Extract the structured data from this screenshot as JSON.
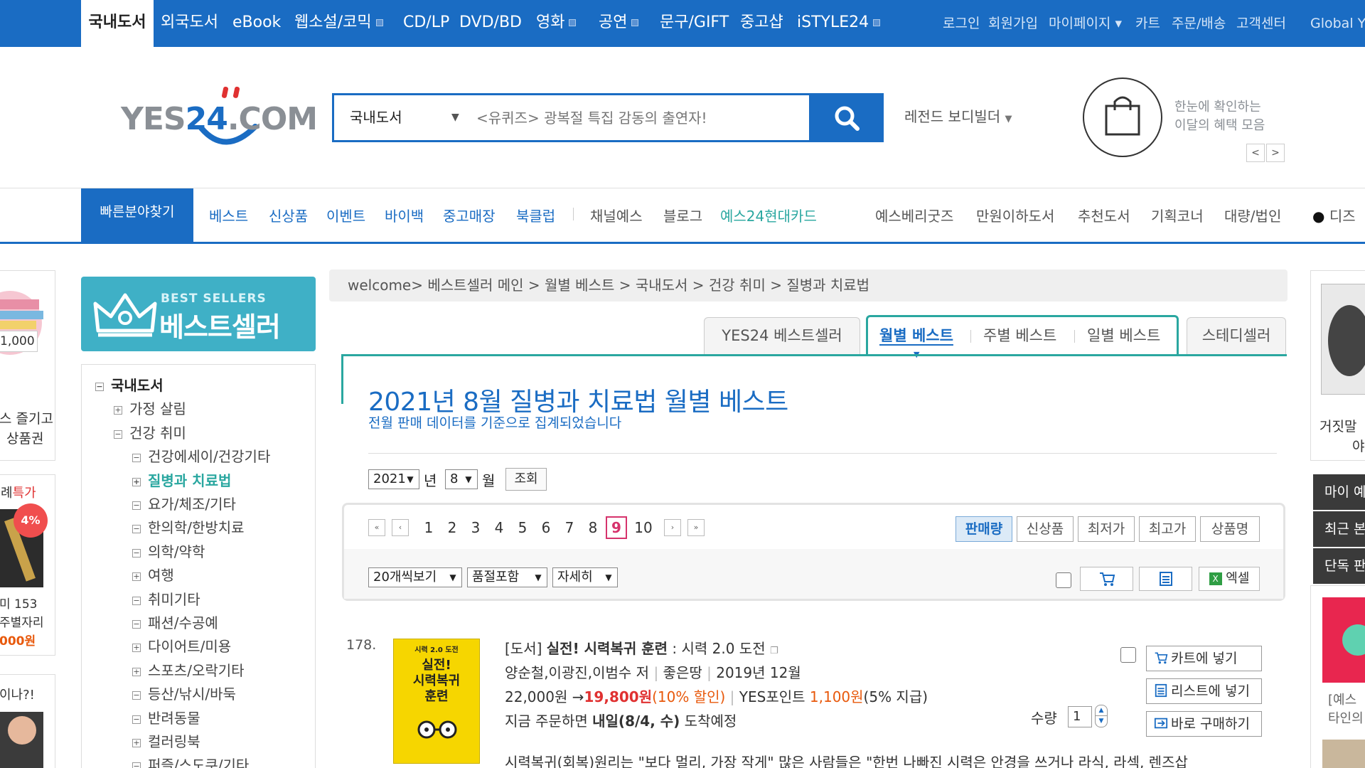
{
  "topnav": {
    "categories": [
      "국내도서",
      "외국도서",
      "eBook",
      "웹소설/코믹",
      "CD/LP",
      "DVD/BD",
      "영화",
      "공연",
      "문구/GIFT",
      "중고샵",
      "iSTYLE24"
    ],
    "utility": [
      "로그인",
      "회원가입",
      "마이페이지 ▾",
      "카트",
      "주문/배송",
      "고객센터",
      "Global Y"
    ]
  },
  "header": {
    "logo_left": "YES",
    "logo_num": "24",
    "logo_right": ".COM",
    "search_category": "국내도서",
    "search_placeholder": "<유퀴즈> 광복절 특집 감동의 출연자!",
    "legend_link": "레전드 보디빌더",
    "benefit_line1": "한눈에 확인하는",
    "benefit_line2": "이달의 혜택 모음",
    "prev": "<",
    "next": ">"
  },
  "gnb": {
    "quick_find": "빠른분야찾기",
    "primary": [
      "베스트",
      "신상품",
      "이벤트",
      "바이백",
      "중고매장",
      "북클럽"
    ],
    "secondary": [
      "채널예스",
      "블로그"
    ],
    "card": "예스24현대카드",
    "right": [
      "예스베리굿즈",
      "만원이하도서",
      "추천도서",
      "기획코너",
      "대량/법인",
      "디즈"
    ]
  },
  "left_ads": {
    "price_badge": "1,000",
    "ad1_line1": "스 즐기고",
    "ad1_line2": "상품권",
    "ad2_title": "특가",
    "ad2_prefix": "례",
    "ad2_badge": "4%",
    "ad2_line1": "미 153",
    "ad2_line2": "주별자리",
    "ad2_price": "000원",
    "ad3_title": "이나?!"
  },
  "bestseller_banner": {
    "en": "BEST SELLERS",
    "ko": "베스트셀러"
  },
  "category_tree": [
    {
      "label": "국내도서",
      "toggle": "−",
      "level": 0,
      "state": "root"
    },
    {
      "label": "가정 살림",
      "toggle": "+",
      "level": 1,
      "state": ""
    },
    {
      "label": "건강 취미",
      "toggle": "−",
      "level": 1,
      "state": ""
    },
    {
      "label": "건강에세이/건강기타",
      "toggle": "−",
      "level": 2,
      "state": ""
    },
    {
      "label": "질병과 치료법",
      "toggle": "+",
      "level": 2,
      "state": "sel"
    },
    {
      "label": "요가/체조/기타",
      "toggle": "−",
      "level": 2,
      "state": ""
    },
    {
      "label": "한의학/한방치료",
      "toggle": "−",
      "level": 2,
      "state": ""
    },
    {
      "label": "의학/약학",
      "toggle": "−",
      "level": 2,
      "state": ""
    },
    {
      "label": "여행",
      "toggle": "+",
      "level": 2,
      "state": ""
    },
    {
      "label": "취미기타",
      "toggle": "−",
      "level": 2,
      "state": ""
    },
    {
      "label": "패션/수공예",
      "toggle": "−",
      "level": 2,
      "state": ""
    },
    {
      "label": "다이어트/미용",
      "toggle": "+",
      "level": 2,
      "state": ""
    },
    {
      "label": "스포츠/오락기타",
      "toggle": "+",
      "level": 2,
      "state": ""
    },
    {
      "label": "등산/낚시/바둑",
      "toggle": "−",
      "level": 2,
      "state": ""
    },
    {
      "label": "반려동물",
      "toggle": "−",
      "level": 2,
      "state": ""
    },
    {
      "label": "컬러링북",
      "toggle": "+",
      "level": 2,
      "state": ""
    },
    {
      "label": "퍼즐/스도쿠/기타",
      "toggle": "−",
      "level": 2,
      "state": ""
    }
  ],
  "breadcrumb": "welcome> 베스트셀러 메인 > 월별 베스트 > 국내도서 > 건강 취미 > 질병과 치료법",
  "tabs": {
    "yes24": "YES24 베스트셀러",
    "monthly": "월별 베스트",
    "weekly": "주별 베스트",
    "daily": "일별 베스트",
    "steady": "스테디셀러"
  },
  "page": {
    "title": "2021년 8월 질병과 치료법 월별 베스트",
    "subtitle": "전월 판매 데이터를 기준으로 집계되었습니다",
    "year": "2021",
    "year_unit": "년",
    "month": "8",
    "month_unit": "월",
    "submit": "조회"
  },
  "pagination": {
    "pages": [
      "1",
      "2",
      "3",
      "4",
      "5",
      "6",
      "7",
      "8",
      "9",
      "10"
    ],
    "current": "9",
    "first": "«",
    "prev": "‹",
    "next": "›",
    "last": "»"
  },
  "sort": [
    "판매량",
    "신상품",
    "최저가",
    "최고가",
    "상품명"
  ],
  "view_options": {
    "per_page": "20개씩보기",
    "soldout": "품절포함",
    "detail": "자세히",
    "excel": "엑셀"
  },
  "product": {
    "rank": "178.",
    "cover_small": "시력 2.0 도전",
    "cover_title1": "실전!",
    "cover_title2": "시력복귀",
    "cover_title3": "훈련",
    "type": "[도서]",
    "title": "실전! 시력복귀 훈련",
    "subtitle": ": 시력 2.0 도전",
    "authors": "양순철,이광진,이범수 저",
    "publisher": "좋은땅",
    "date": "2019년 12월",
    "list_price": "22,000원",
    "arrow": "→",
    "sale_price": "19,800원",
    "discount": "(10% 할인)",
    "points_label": "YES포인트",
    "points": "1,100원",
    "points_rate": "(5% 지급)",
    "delivery_prefix": "지금 주문하면",
    "delivery_date": "내일(8/4, 수)",
    "delivery_suffix": "도착예정",
    "qty_label": "수량",
    "qty": "1",
    "btn_cart": "카트에 넣기",
    "btn_list": "리스트에 넣기",
    "btn_buy": "바로 구매하기",
    "description": "시력복귀(회복)원리는 \"보다 멀리, 가장 작게\" 많은 사람들은 \"한번 나빠진 시력은 안경을 쓰거나 라식, 라섹, 렌즈삽"
  },
  "right_column": {
    "book_caption1": "거짓말",
    "book_caption2": "야",
    "tabs": [
      "마이 예스",
      "최근 본",
      "단독 판"
    ],
    "ad_line1": "[예스",
    "ad_line2": "타인의"
  },
  "colors": {
    "brand_blue": "#1a6cc3",
    "teal": "#2aa7a0",
    "sale_red": "#e03131",
    "current_page": "#d6336c"
  }
}
